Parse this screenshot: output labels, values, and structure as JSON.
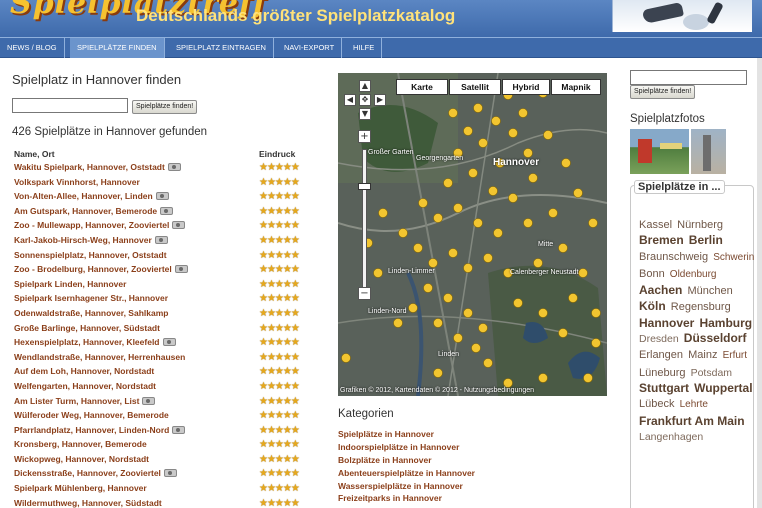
{
  "header": {
    "logo_text": "Spielplatztreff",
    "tagline": "Deutschlands größter Spielplatzkatalog"
  },
  "nav": [
    {
      "label": "NEWS / BLOG",
      "active": false
    },
    {
      "label": "SPIELPLÄTZE FINDEN",
      "active": true
    },
    {
      "label": "SPIELPLATZ EINTRAGEN",
      "active": false
    },
    {
      "label": "NAVI-EXPORT",
      "active": false
    },
    {
      "label": "HILFE",
      "active": false
    }
  ],
  "search": {
    "title": "Spielplatz in Hannover finden",
    "input_value": "",
    "button_label": "Spielplätze finden!"
  },
  "results": {
    "count_text": "426 Spielplätze in Hannover gefunden",
    "col_name": "Name, Ort",
    "col_impression": "Eindruck",
    "rows": [
      {
        "name": "Wakitu Spielpark, Hannover, Oststadt",
        "photo": true,
        "stars": 5
      },
      {
        "name": "Volkspark Vinnhorst, Hannover",
        "photo": false,
        "stars": 5
      },
      {
        "name": "Von-Alten-Allee, Hannover, Linden",
        "photo": true,
        "stars": 5
      },
      {
        "name": "Am Gutspark, Hannover, Bemerode",
        "photo": true,
        "stars": 5
      },
      {
        "name": "Zoo - Mullewapp, Hannover, Zooviertel",
        "photo": true,
        "stars": 5
      },
      {
        "name": "Karl-Jakob-Hirsch-Weg, Hannover",
        "photo": true,
        "stars": 5
      },
      {
        "name": "Sonnenspielplatz, Hannover, Oststadt",
        "photo": false,
        "stars": 5
      },
      {
        "name": "Zoo - Brodelburg, Hannover, Zooviertel",
        "photo": true,
        "stars": 5
      },
      {
        "name": "Spielpark Linden, Hannover",
        "photo": false,
        "stars": 5
      },
      {
        "name": "Spielpark Isernhagener Str., Hannover",
        "photo": false,
        "stars": 5
      },
      {
        "name": "Odenwaldstraße, Hannover, Sahlkamp",
        "photo": false,
        "stars": 5
      },
      {
        "name": "Große Barlinge, Hannover, Südstadt",
        "photo": false,
        "stars": 5
      },
      {
        "name": "Hexenspielplatz, Hannover, Kleefeld",
        "photo": true,
        "stars": 5
      },
      {
        "name": "Wendlandstraße, Hannover, Herrenhausen",
        "photo": false,
        "stars": 5
      },
      {
        "name": "Auf dem Loh, Hannover, Nordstadt",
        "photo": false,
        "stars": 5
      },
      {
        "name": "Welfengarten, Hannover, Nordstadt",
        "photo": false,
        "stars": 5
      },
      {
        "name": "Am Lister Turm, Hannover, List",
        "photo": true,
        "stars": 5
      },
      {
        "name": "Wülferoder Weg, Hannover, Bemerode",
        "photo": false,
        "stars": 5
      },
      {
        "name": "Pfarrlandplatz, Hannover, Linden-Nord",
        "photo": true,
        "stars": 5
      },
      {
        "name": "Kronsberg, Hannover, Bemerode",
        "photo": false,
        "stars": 5
      },
      {
        "name": "Wickopweg, Hannover, Nordstadt",
        "photo": false,
        "stars": 5
      },
      {
        "name": "Dickensstraße, Hannover, Zooviertel",
        "photo": true,
        "stars": 5
      },
      {
        "name": "Spielpark Mühlenberg, Hannover",
        "photo": false,
        "stars": 5
      },
      {
        "name": "Wildermuthweg, Hannover, Südstadt",
        "photo": false,
        "stars": 5
      }
    ]
  },
  "map": {
    "types": [
      "Karte",
      "Satellit",
      "Hybrid",
      "Mapnik"
    ],
    "active_type": "Satellit",
    "city_label": "Hannover",
    "labels": [
      "Großer Garten",
      "Georgengarten",
      "Linden-Limmer",
      "Linden-Nord",
      "Calenberger Neustadt",
      "Mitte",
      "Linden"
    ],
    "copyright": "Grafiken © 2012, Kartendaten © 2012 - Nutzungsbedingungen",
    "pan_up": "▲",
    "pan_left": "◀",
    "pan_center": "✥",
    "pan_right": "▶",
    "pan_down": "▼",
    "zoom_in": "+",
    "zoom_out": "−"
  },
  "categories": {
    "title": "Kategorien",
    "items": [
      "Spielplätze in Hannover",
      "Indoorspielplätze in Hannover",
      "Bolzplätze in Hannover",
      "Abenteuerspielplätze in Hannover",
      "Wasserspielplätze in Hannover",
      "Freizeitparks in Hannover"
    ]
  },
  "sidebar": {
    "search_value": "",
    "button_label": "Spielplätze finden!",
    "photos_title": "Spielplatzfotos",
    "box_title": "Spielplätze in ...",
    "cities": [
      {
        "name": "Kassel",
        "size": "m"
      },
      {
        "name": "Nürnberg",
        "size": "m"
      },
      {
        "name": "Bremen",
        "size": "l"
      },
      {
        "name": "Berlin",
        "size": "l"
      },
      {
        "name": "Braunschweig",
        "size": "m"
      },
      {
        "name": "Schwerin",
        "size": "s"
      },
      {
        "name": "Bonn",
        "size": "m"
      },
      {
        "name": "Oldenburg",
        "size": "s"
      },
      {
        "name": "Aachen",
        "size": "l"
      },
      {
        "name": "München",
        "size": "m"
      },
      {
        "name": "Köln",
        "size": "l"
      },
      {
        "name": "Regensburg",
        "size": "m"
      },
      {
        "name": "Hannover",
        "size": "l"
      },
      {
        "name": "Hamburg",
        "size": "l"
      },
      {
        "name": "Dresden",
        "size": "xs"
      },
      {
        "name": "Düsseldorf",
        "size": "l"
      },
      {
        "name": "Erlangen",
        "size": "m"
      },
      {
        "name": "Mainz",
        "size": "m"
      },
      {
        "name": "Erfurt",
        "size": "s"
      },
      {
        "name": "Lüneburg",
        "size": "m"
      },
      {
        "name": "Potsdam",
        "size": "xs"
      },
      {
        "name": "Stuttgart",
        "size": "l"
      },
      {
        "name": "Wuppertal",
        "size": "l"
      },
      {
        "name": "Lübeck",
        "size": "m"
      },
      {
        "name": "Lehrte",
        "size": "s"
      },
      {
        "name": "Frankfurt Am Main",
        "size": "l"
      },
      {
        "name": "Langenhagen",
        "size": "xs"
      }
    ]
  },
  "colors": {
    "header_blue": "#3e6aab",
    "link_brown": "#8b3f1a",
    "star_gold": "#e6a81c",
    "logo_yellow": "#f6c230"
  }
}
